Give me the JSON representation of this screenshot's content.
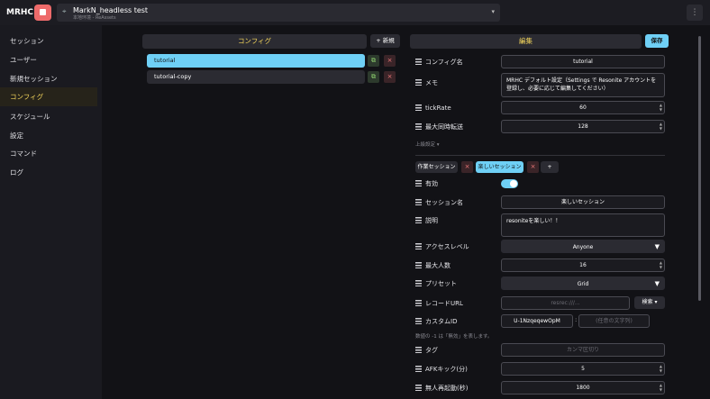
{
  "app": {
    "title": "MRHC",
    "menu_icon": "⋮"
  },
  "host": {
    "name": "MarkN_headless test",
    "sub": "本地环境 - ReAssets"
  },
  "sidebar": {
    "items": [
      {
        "label": "セッション"
      },
      {
        "label": "ユーザー"
      },
      {
        "label": "新規セッション"
      },
      {
        "label": "コンフィグ",
        "active": true
      },
      {
        "label": "スケジュール"
      },
      {
        "label": "設定"
      },
      {
        "label": "コマンド"
      },
      {
        "label": "ログ"
      }
    ]
  },
  "config_list": {
    "header": "コンフィグ",
    "new_label": "+ 新規",
    "items": [
      {
        "name": "tutorial",
        "selected": true
      },
      {
        "name": "tutorial-copy",
        "selected": false
      }
    ]
  },
  "editor": {
    "header": "編集",
    "save_label": "保存",
    "config_name": {
      "label": "コンフィグ名",
      "value": "tutorial"
    },
    "memo": {
      "label": "メモ",
      "value": "MRHC デフォルト設定（Settings で Resonite アカウントを登録し、必要に応じて編集してください）"
    },
    "tick_rate": {
      "label": "tickRate",
      "value": "60"
    },
    "max_transfers": {
      "label": "最大同時転送",
      "value": "128"
    },
    "advanced_label": "上級設定 ▾",
    "session_tabs": {
      "work_label": "作業セッション",
      "new_label": "楽しいセッション",
      "add_label": "+"
    },
    "enabled_label": "有効",
    "session_name": {
      "label": "セッション名",
      "value": "楽しいセッション"
    },
    "description": {
      "label": "説明",
      "value": "resoniteを楽しい！！"
    },
    "access_level": {
      "label": "アクセスレベル",
      "value": "Anyone"
    },
    "max_users": {
      "label": "最大人数",
      "value": "16"
    },
    "preset": {
      "label": "プリセット",
      "value": "Grid"
    },
    "record_url": {
      "label": "レコードURL",
      "placeholder": "resrec:///...",
      "search_label": "検索 ▾"
    },
    "custom_id": {
      "label": "カスタムID",
      "prefix": "U-1NzqeqewOpM",
      "separator": ":",
      "placeholder": "(任意の文字列)"
    },
    "note": "数値の -1 は「無効」を表します。",
    "tags": {
      "label": "タグ",
      "placeholder": "カンマ区切り"
    },
    "afk_kick": {
      "label": "AFKキック(分)",
      "value": "5"
    },
    "auto_restart": {
      "label": "無人再起動(秒)",
      "value": "1800"
    }
  }
}
